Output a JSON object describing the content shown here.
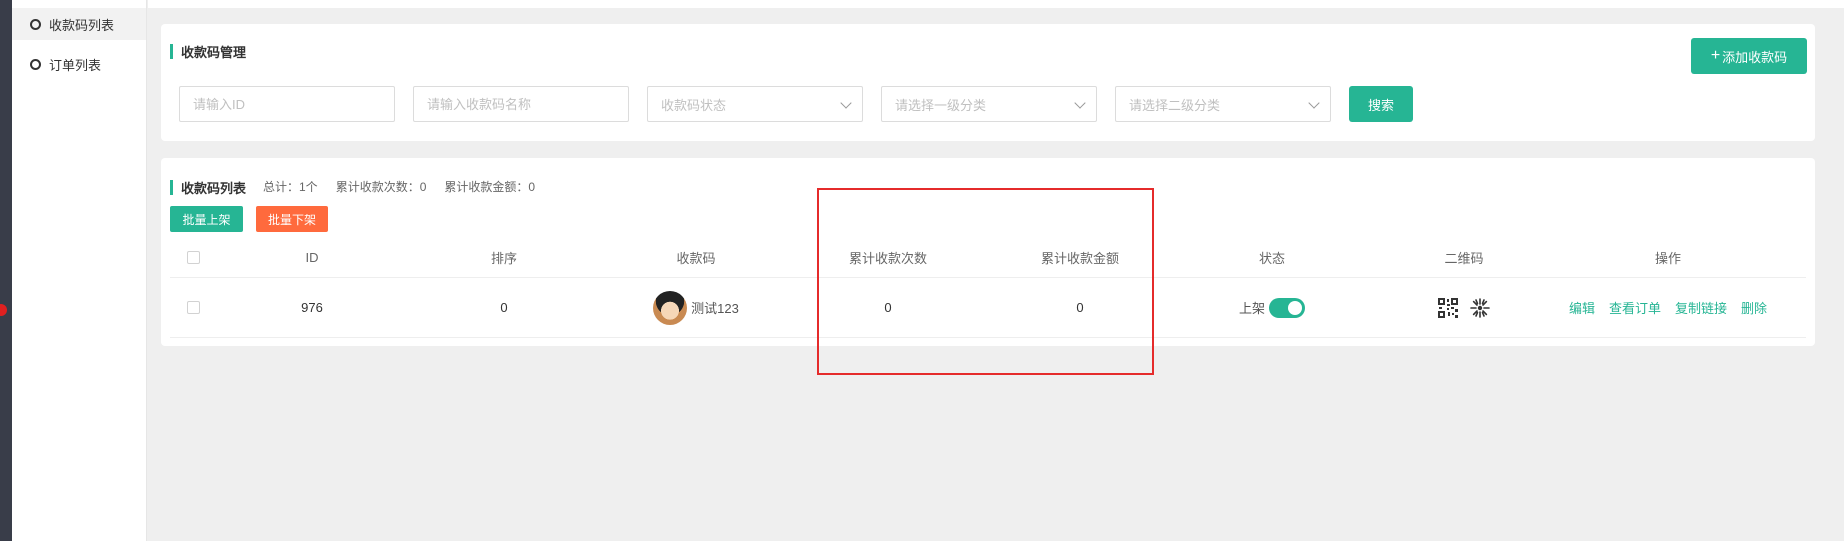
{
  "sidebar": {
    "items": [
      {
        "label": "收款码列表",
        "active": true
      },
      {
        "label": "订单列表",
        "active": false
      }
    ]
  },
  "filter": {
    "title": "收款码管理",
    "add_button_label": "添加收款码",
    "id_placeholder": "请输入ID",
    "name_placeholder": "请输入收款码名称",
    "status_placeholder": "收款码状态",
    "category1_placeholder": "请选择一级分类",
    "category2_placeholder": "请选择二级分类",
    "search_button_label": "搜索"
  },
  "list": {
    "title": "收款码列表",
    "stat_total": "总计：1个",
    "stat_count": "累计收款次数：0",
    "stat_amount": "累计收款金额：0",
    "batch_on_label": "批量上架",
    "batch_off_label": "批量下架",
    "columns": {
      "id": "ID",
      "sort": "排序",
      "code": "收款码",
      "count": "累计收款次数",
      "amount": "累计收款金额",
      "status": "状态",
      "qrcode": "二维码",
      "actions": "操作"
    },
    "rows": [
      {
        "id": "976",
        "sort": "0",
        "code_name": "测试123",
        "count": "0",
        "amount": "0",
        "status_label": "上架",
        "status_on": true,
        "actions": {
          "edit": "编辑",
          "view_orders": "查看订单",
          "copy_link": "复制链接",
          "delete": "删除"
        }
      }
    ]
  },
  "colors": {
    "accent": "#26b594",
    "danger": "#ff6a3d",
    "highlight": "#e52b2b"
  }
}
